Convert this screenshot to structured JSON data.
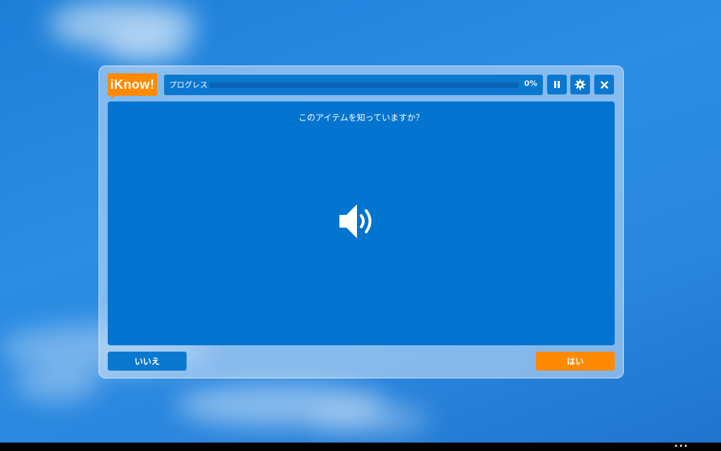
{
  "app": {
    "logo_text": "iKnow!",
    "brand_color": "#ff8a00",
    "accent_color": "#0374d0"
  },
  "header": {
    "progress_label": "プログレス",
    "progress_percent_text": "0%",
    "progress_fraction": 0
  },
  "toolbar": {
    "pause_icon": "pause-icon",
    "settings_icon": "gear-icon",
    "close_icon": "close-icon"
  },
  "card": {
    "question": "このアイテムを知っていますか？",
    "audio_icon": "speaker-icon"
  },
  "answers": {
    "no_label": "いいえ",
    "yes_label": "はい"
  },
  "taskbar": {
    "overflow_text": "•••"
  }
}
